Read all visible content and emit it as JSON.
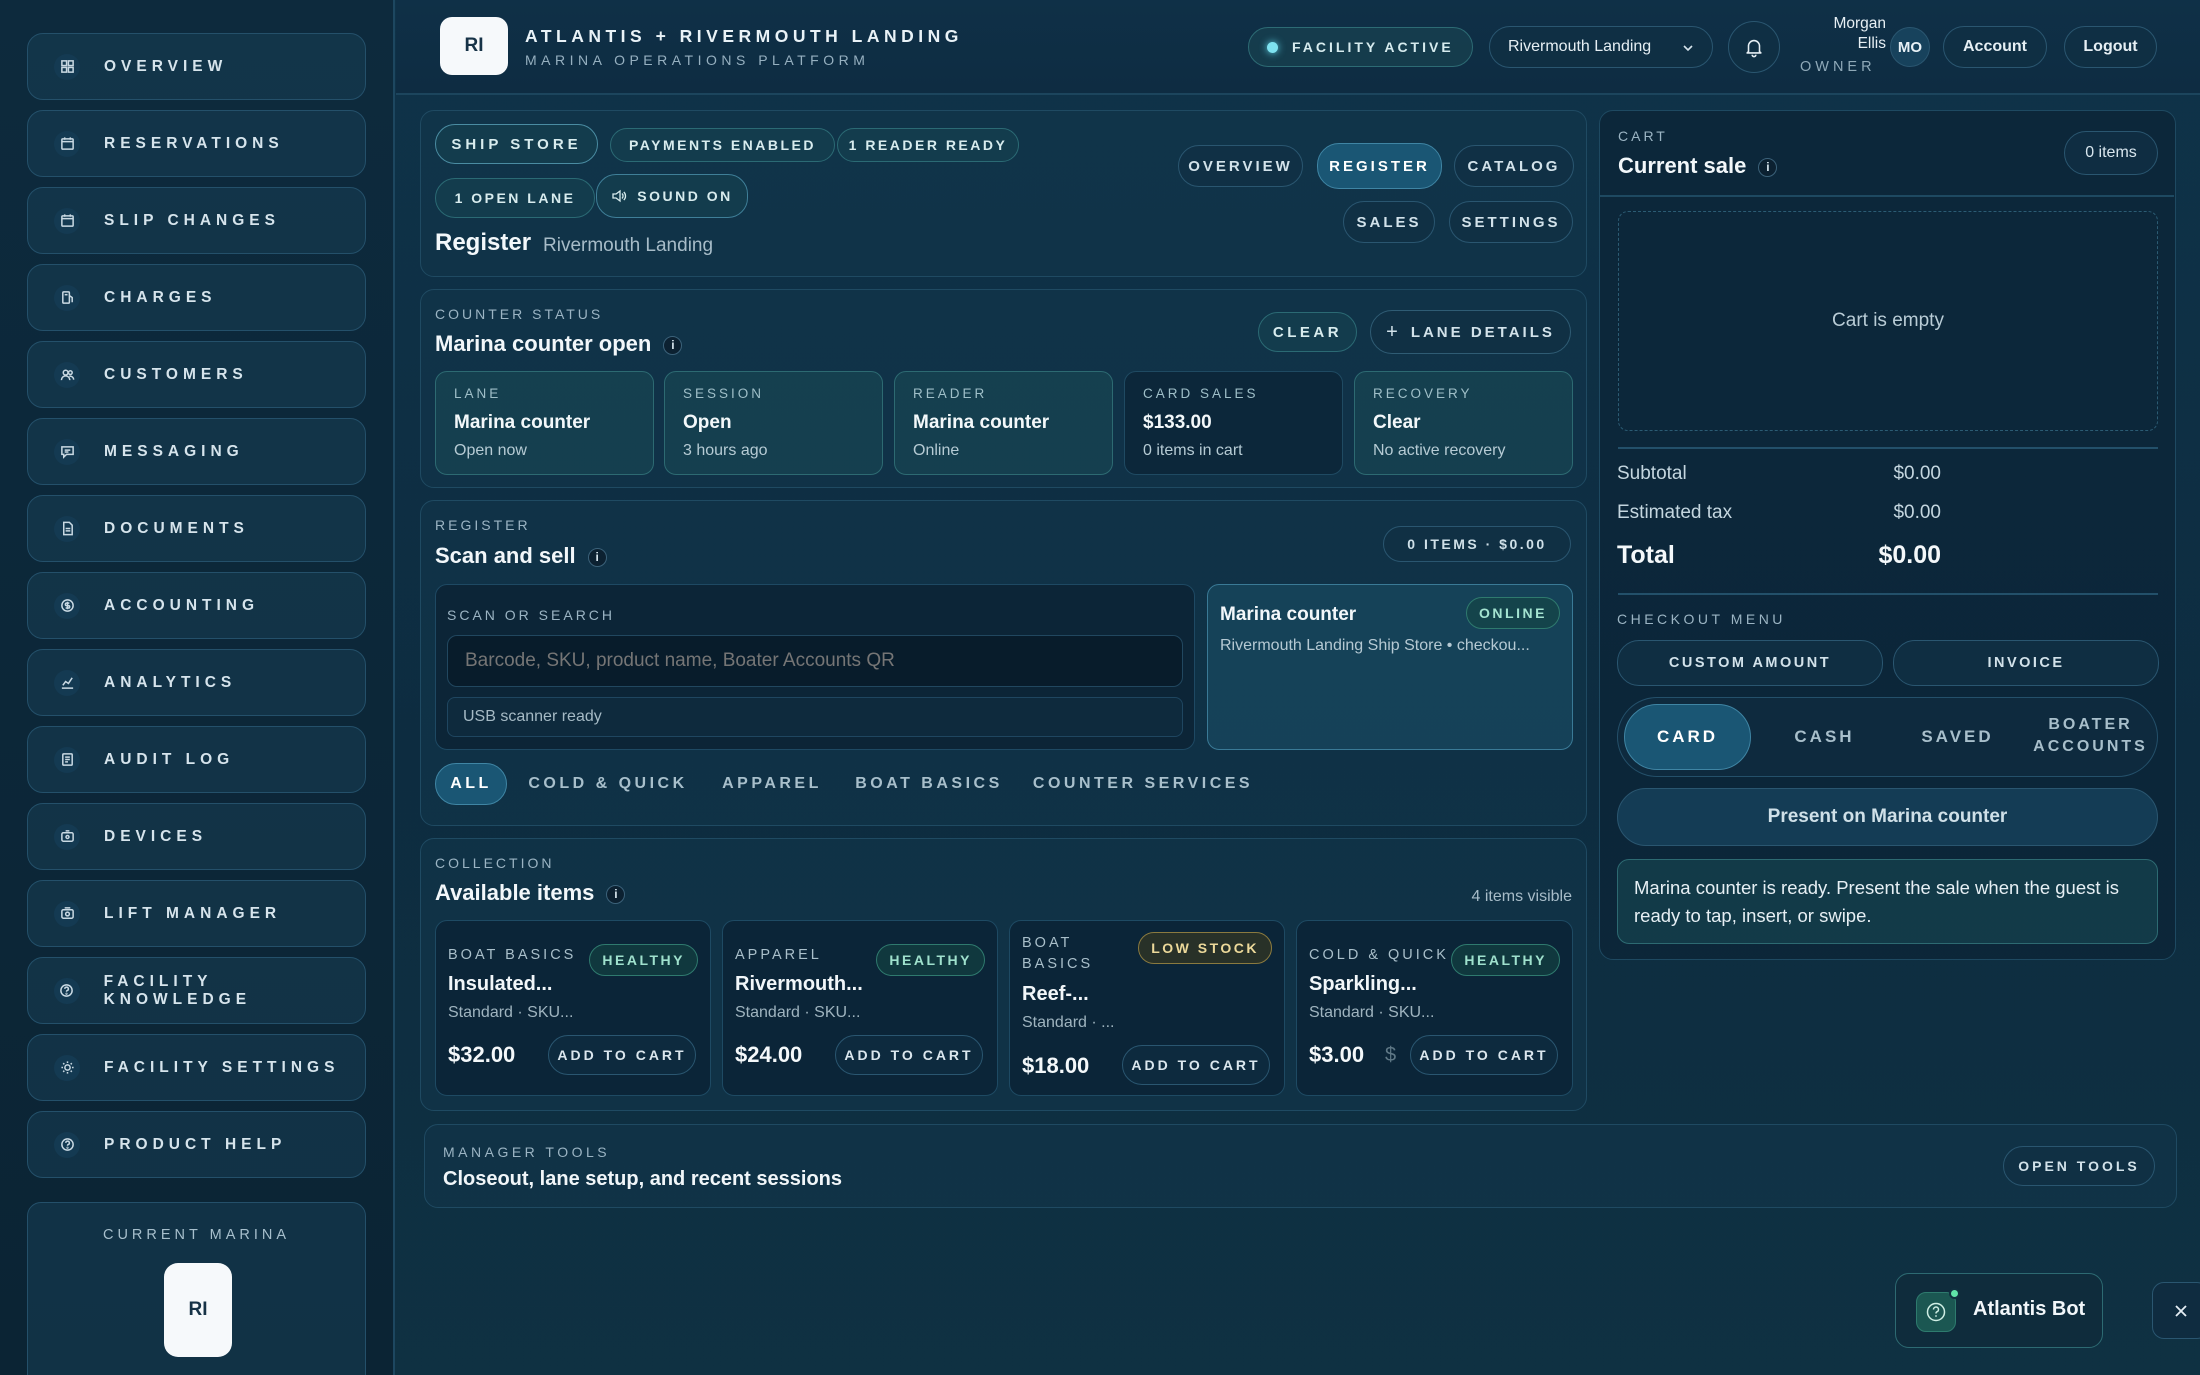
{
  "header": {
    "logo_initials": "RI",
    "title": "ATLANTIS + RIVERMOUTH LANDING",
    "subtitle": "MARINA OPERATIONS PLATFORM",
    "facility_status": "FACILITY ACTIVE",
    "location_select": "Rivermouth Landing",
    "user_name_line1": "Morgan",
    "user_name_line2": "Ellis",
    "user_role": "OWNER",
    "user_initials": "MO",
    "account_label": "Account",
    "logout_label": "Logout"
  },
  "sidebar": {
    "items": [
      {
        "label": "OVERVIEW",
        "icon": "grid-icon"
      },
      {
        "label": "RESERVATIONS",
        "icon": "calendar-icon"
      },
      {
        "label": "SLIP CHANGES",
        "icon": "calendar-icon"
      },
      {
        "label": "CHARGES",
        "icon": "fuel-icon"
      },
      {
        "label": "CUSTOMERS",
        "icon": "users-icon"
      },
      {
        "label": "MESSAGING",
        "icon": "message-icon"
      },
      {
        "label": "DOCUMENTS",
        "icon": "document-icon"
      },
      {
        "label": "ACCOUNTING",
        "icon": "dollar-icon"
      },
      {
        "label": "ANALYTICS",
        "icon": "chart-icon"
      },
      {
        "label": "AUDIT LOG",
        "icon": "log-icon"
      },
      {
        "label": "DEVICES",
        "icon": "device-icon"
      },
      {
        "label": "LIFT MANAGER",
        "icon": "lift-icon"
      },
      {
        "label": "FACILITY KNOWLEDGE",
        "icon": "help-icon"
      },
      {
        "label": "FACILITY SETTINGS",
        "icon": "sun-icon"
      },
      {
        "label": "PRODUCT HELP",
        "icon": "help-icon"
      }
    ],
    "current_marina_label": "CURRENT MARINA",
    "current_marina_initials": "RI"
  },
  "register_header": {
    "pills": [
      "SHIP STORE",
      "PAYMENTS ENABLED",
      "1 READER READY",
      "1 OPEN LANE",
      "SOUND ON"
    ],
    "tabs": [
      "OVERVIEW",
      "REGISTER",
      "CATALOG",
      "SALES",
      "SETTINGS"
    ],
    "active_tab": "REGISTER",
    "title": "Register",
    "location": "Rivermouth Landing"
  },
  "counter_status": {
    "kicker": "COUNTER STATUS",
    "title": "Marina counter open",
    "clear_label": "CLEAR",
    "lane_details_label": "LANE DETAILS",
    "stats": [
      {
        "key": "LANE",
        "value": "Marina counter",
        "sub": "Open now"
      },
      {
        "key": "SESSION",
        "value": "Open",
        "sub": "3 hours ago"
      },
      {
        "key": "READER",
        "value": "Marina counter",
        "sub": "Online"
      },
      {
        "key": "CARD SALES",
        "value": "$133.00",
        "sub": "0 items in cart"
      },
      {
        "key": "RECOVERY",
        "value": "Clear",
        "sub": "No active recovery"
      }
    ]
  },
  "scan": {
    "kicker": "REGISTER",
    "title": "Scan and sell",
    "summary": "0 ITEMS · $0.00",
    "search_label": "SCAN OR SEARCH",
    "search_placeholder": "Barcode, SKU, product name, Boater Accounts QR",
    "scanner_status": "USB scanner ready",
    "reader_name": "Marina counter",
    "reader_status": "ONLINE",
    "reader_detail": "Rivermouth Landing Ship Store • checkou...",
    "filters": [
      "ALL",
      "COLD & QUICK",
      "APPAREL",
      "BOAT BASICS",
      "COUNTER SERVICES"
    ]
  },
  "collection": {
    "kicker": "COLLECTION",
    "title": "Available items",
    "count": "4 items visible",
    "products": [
      {
        "category": "BOAT BASICS",
        "name": "Insulated...",
        "detail": "Standard · SKU...",
        "price": "$32.00",
        "stock": "HEALTHY",
        "add": "ADD TO CART"
      },
      {
        "category": "APPAREL",
        "name": "Rivermouth...",
        "detail": "Standard · SKU...",
        "price": "$24.00",
        "stock": "HEALTHY",
        "add": "ADD TO CART"
      },
      {
        "category_line1": "BOAT",
        "category_line2": "BASICS",
        "name": "Reef-...",
        "detail": "Standard · ...",
        "price": "$18.00",
        "stock": "LOW STOCK",
        "add": "ADD TO CART"
      },
      {
        "category": "COLD & QUICK",
        "name": "Sparkling...",
        "detail": "Standard · SKU...",
        "price": "$3.00",
        "price_overflow": "$",
        "stock": "HEALTHY",
        "add": "ADD TO CART"
      }
    ]
  },
  "manager_tools": {
    "kicker": "MANAGER TOOLS",
    "title": "Closeout, lane setup, and recent sessions",
    "button": "OPEN TOOLS"
  },
  "cart": {
    "kicker": "CART",
    "title": "Current sale",
    "items_badge": "0 items",
    "empty_text": "Cart is empty",
    "subtotal_label": "Subtotal",
    "subtotal": "$0.00",
    "tax_label": "Estimated tax",
    "tax": "$0.00",
    "total_label": "Total",
    "total": "$0.00",
    "checkout_menu_label": "CHECKOUT MENU",
    "custom_amount": "CUSTOM AMOUNT",
    "invoice": "INVOICE",
    "methods": [
      "CARD",
      "CASH",
      "SAVED"
    ],
    "method_boater_line1": "BOATER",
    "method_boater_line2": "ACCOUNTS",
    "present_button": "Present on Marina counter",
    "ready_message": "Marina counter is ready. Present the sale when the guest is ready to tap, insert, or swipe."
  },
  "bot": {
    "label": "Atlantis Bot"
  }
}
